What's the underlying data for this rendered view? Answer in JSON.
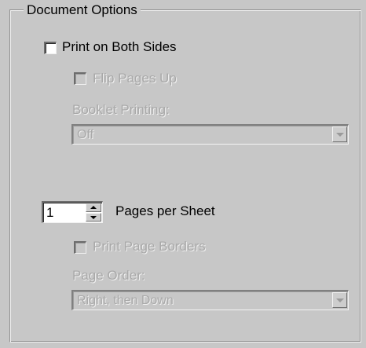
{
  "group": {
    "title": "Document Options"
  },
  "print_both_sides": {
    "label": "Print on Both Sides",
    "checked": false
  },
  "flip_pages_up": {
    "label": "Flip Pages Up",
    "checked": false,
    "enabled": false
  },
  "booklet_printing": {
    "label": "Booklet Printing:",
    "value": "Off",
    "enabled": false
  },
  "pages_per_sheet": {
    "value": "1",
    "label": "Pages per Sheet"
  },
  "print_page_borders": {
    "label": "Print Page Borders",
    "checked": false,
    "enabled": false
  },
  "page_order": {
    "label": "Page Order:",
    "value": "Right, then Down",
    "enabled": false
  },
  "icons": {
    "combo_arrow": "chevron-down-icon",
    "spin_up": "spin-up-icon",
    "spin_down": "spin-down-icon"
  }
}
